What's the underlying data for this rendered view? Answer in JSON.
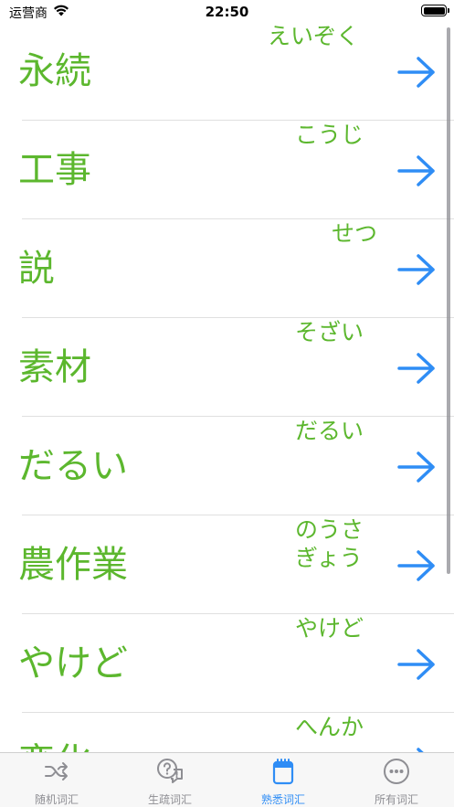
{
  "status_bar": {
    "carrier": "运营商",
    "time": "22:50"
  },
  "words": [
    {
      "kanji": "永続",
      "reading": "えいぞく"
    },
    {
      "kanji": "工事",
      "reading": "こうじ"
    },
    {
      "kanji": "説",
      "reading": "せつ"
    },
    {
      "kanji": "素材",
      "reading": "そざい"
    },
    {
      "kanji": "だるい",
      "reading": "だるい"
    },
    {
      "kanji": "農作業",
      "reading": "のうさぎょう"
    },
    {
      "kanji": "やけど",
      "reading": "やけど"
    },
    {
      "kanji": "変化",
      "reading": "へんか"
    }
  ],
  "tabs": [
    {
      "label": "随机词汇",
      "icon": "shuffle-icon",
      "active": false
    },
    {
      "label": "生疏词汇",
      "icon": "question-bubble-icon",
      "active": false
    },
    {
      "label": "熟悉词汇",
      "icon": "notepad-icon",
      "active": true
    },
    {
      "label": "所有词汇",
      "icon": "more-dots-icon",
      "active": false
    }
  ],
  "colors": {
    "word": "#5cb72e",
    "arrow": "#2f8df5",
    "tab_active": "#2f8df5",
    "tab_inactive": "#8e8e93"
  }
}
